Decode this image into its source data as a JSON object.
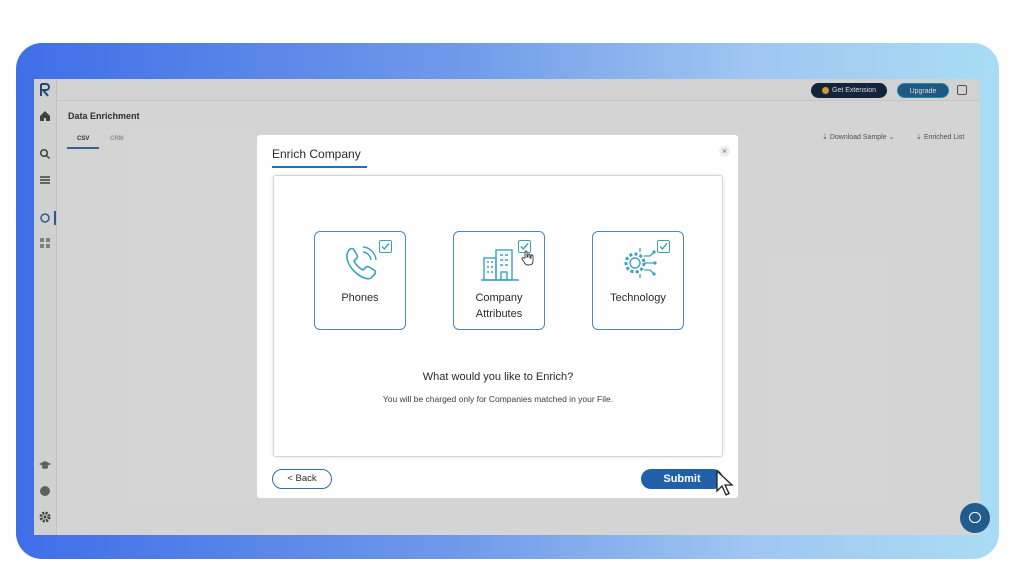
{
  "app": {
    "page_title": "Data Enrichment",
    "tabs": [
      {
        "label": "CSV",
        "active": true
      },
      {
        "label": "CRM",
        "active": false
      }
    ],
    "topbar": {
      "get_extension_label": "Get Extension",
      "upgrade_label": "Upgrade"
    },
    "links": {
      "download_sample": "Download Sample",
      "enriched_list": "Enriched List"
    }
  },
  "modal": {
    "title": "Enrich Company",
    "options": [
      {
        "label": "Phones",
        "checked": true,
        "icon": "phone-icon"
      },
      {
        "label_line1": "Company",
        "label_line2": "Attributes",
        "checked": true,
        "icon": "building-icon"
      },
      {
        "label": "Technology",
        "checked": true,
        "icon": "technology-gear-icon"
      }
    ],
    "question": "What would you like to Enrich?",
    "note": "You will be charged only for Companies matched in your File.",
    "back_label": "< Back",
    "submit_label": "Submit"
  },
  "colors": {
    "accent": "#215fa8",
    "card_border": "#4a86c8",
    "check": "#3aa0b8",
    "teal_icon": "#3ba3bd"
  }
}
